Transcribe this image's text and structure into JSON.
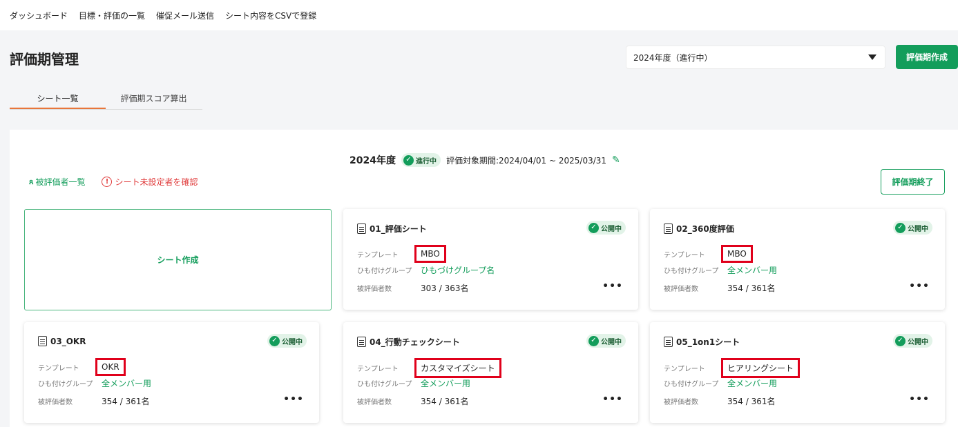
{
  "topnav": [
    "ダッシュボード",
    "目標・評価の一覧",
    "催促メール送信",
    "シート内容をCSVで登録"
  ],
  "page_title": "評価期管理",
  "period_select": {
    "value": "2024年度（進行中）"
  },
  "create_period_button": "評価期作成",
  "tabs": [
    {
      "label": "シート一覧",
      "active": true
    },
    {
      "label": "評価期スコア算出",
      "active": false
    }
  ],
  "period": {
    "year": "2024年度",
    "status": "進行中",
    "range": "評価対象期間:2024/04/01 ~ 2025/03/31"
  },
  "links": {
    "evaluatees": "被評価者一覧",
    "unassigned": "シート未設定者を確認"
  },
  "end_period_button": "評価期終了",
  "create_sheet": "シート作成",
  "card_labels": {
    "template": "テンプレート",
    "group": "ひも付けグループ",
    "count": "被評価者数"
  },
  "cards": [
    {
      "title": "01_評価シート",
      "status": "公開中",
      "template": "MBO",
      "group": "ひもづけグループ名",
      "count": "303 / 363名"
    },
    {
      "title": "02_360度評価",
      "status": "公開中",
      "template": "MBO",
      "group": "全メンバー用",
      "count": "354 / 361名"
    },
    {
      "title": "03_OKR",
      "status": "公開中",
      "template": "OKR",
      "group": "全メンバー用",
      "count": "354 / 361名"
    },
    {
      "title": "04_行動チェックシート",
      "status": "公開中",
      "template": "カスタマイズシート",
      "group": "全メンバー用",
      "count": "354 / 361名"
    },
    {
      "title": "05_1on1シート",
      "status": "公開中",
      "template": "ヒアリングシート",
      "group": "全メンバー用",
      "count": "354 / 361名"
    }
  ],
  "colors": {
    "accent": "#139d5b",
    "tab_active": "#e8763a",
    "highlight": "#e0001b",
    "warning": "#e03c3c"
  },
  "icons": [
    "document-icon",
    "check-circle-icon",
    "pencil-icon",
    "users-icon",
    "warning-icon",
    "more-icon",
    "caret-down-icon"
  ]
}
